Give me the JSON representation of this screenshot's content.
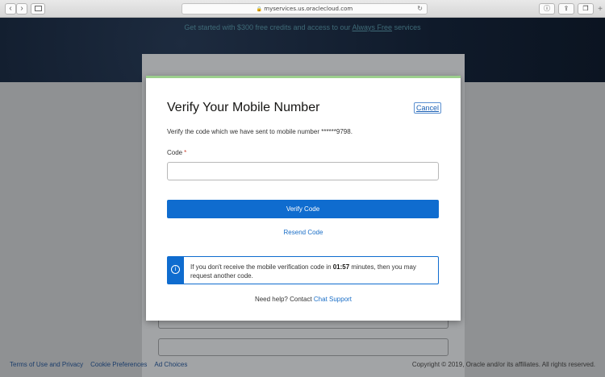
{
  "browser": {
    "url": "myservices.us.oraclecloud.com",
    "back_icon": "chevron-left-icon",
    "forward_icon": "chevron-right-icon",
    "sidebar_icon": "sidebar-icon",
    "reload_icon": "reload-icon",
    "info_icon": "info-icon",
    "share_icon": "share-icon",
    "tabs_icon": "tabs-icon",
    "new_tab": "+"
  },
  "banner": {
    "promo_prefix": "Get started with $300 free credits and access to our ",
    "promo_link": "Always Free",
    "promo_suffix": " services"
  },
  "modal": {
    "title": "Verify Your Mobile Number",
    "cancel_label": "Cancel",
    "description": "Verify the code which we have sent to mobile number ******9798.",
    "code_label": "Code",
    "required_marker": "*",
    "code_value": "",
    "verify_button": "Verify Code",
    "resend_label": "Resend Code",
    "info": {
      "text_before": "If you don't receive the mobile verification code in ",
      "timer": "01:57",
      "text_after": " minutes, then you may request another code."
    },
    "help_prefix": "Need help? Contact ",
    "help_link": "Chat Support"
  },
  "footer": {
    "links": [
      "Terms of Use and Privacy",
      "Cookie Preferences",
      "Ad Choices"
    ],
    "copyright": "Copyright © 2019, Oracle and/or its affiliates. All rights reserved."
  },
  "colors": {
    "accent": "#0f6ccf",
    "modal_top_border": "#9ccf8d",
    "banner_bg": "#0f1a2a"
  }
}
